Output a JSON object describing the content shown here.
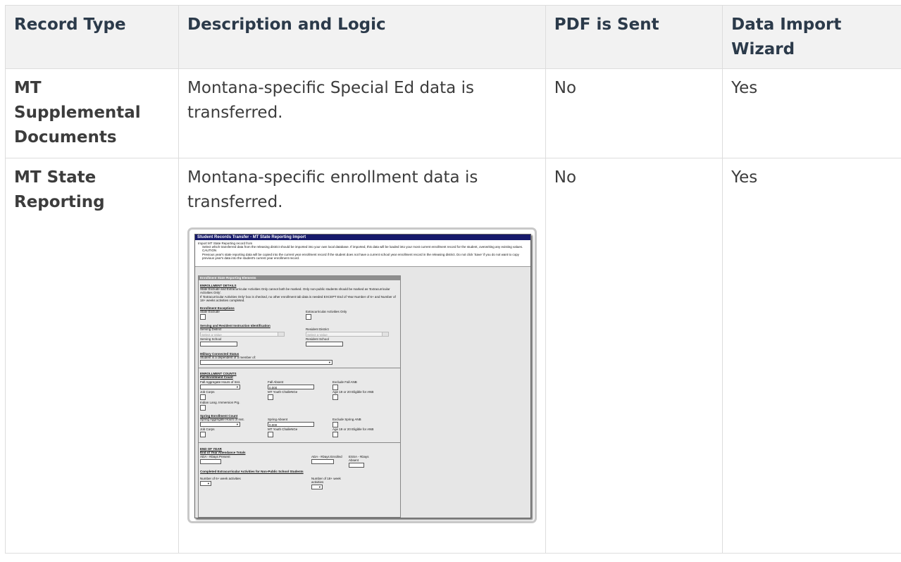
{
  "headers": [
    "Record Type",
    "Description and Logic",
    "PDF is Sent",
    "Data Import Wizard"
  ],
  "rows": [
    {
      "record_type": "MT Supplemental Documents",
      "description": "Montana-specific Special Ed data is transferred.",
      "pdf_sent": "No",
      "import_wizard": "Yes"
    },
    {
      "record_type": "MT State Reporting",
      "description": "Montana-specific enrollment data is transferred.",
      "pdf_sent": "No",
      "import_wizard": "Yes"
    }
  ],
  "shot": {
    "title": "Student Records Transfer - MT State Reporting Import",
    "import_line1": "Import MT State Reporting record from",
    "import_line2": "Select which transferred data from the releasing district should be imported into your own local database. If imported, this data will be loaded into your most current enrollment record for the student, overwriting any existing values.",
    "caution": "CAUTION",
    "caution_text": "Previous year's state reporting data will be copied into the current year enrollment record if the student does not have a current school year enrollment record in the releasing district. Do not click 'Save' if you do not want to copy previous year's data into the student's current year enrollment record.",
    "panel_title": "Enrollment State Reporting Elements",
    "enrollment_details": "ENROLLMENT DETAILS",
    "details_text1": "State Exclude and Extracurricular Activities Only cannot both be marked. Only non-public students should be marked as 'Extracurricular Activities Only'.",
    "details_text2": "If 'Extracurricular Activities Only' box is checked, no other enrollment tab data is needed EXCEPT End of Year Number of 6+ and Number of 18+ weeks activities completed.",
    "enrollment_exceptions": "Enrollment Exceptions",
    "state_exclude": "State Exclude",
    "extracurricular_only": "Extracurricular Activities Only",
    "serving_resident": "Serving and Resident Instruction Identification",
    "serving_district": "Serving District",
    "resident_district": "Resident District",
    "select_value": "Select a Value",
    "serving_school": "Serving School",
    "resident_school": "Resident School",
    "military": "Military Connected Status",
    "military_text": "Student is a dependent of a member of:",
    "enrollment_counts": "ENROLLMENT COUNTS",
    "fall_count": "Fall Enrollment Count",
    "fall_hours": "Fall Aggregate Hours of Inst.",
    "fall_absent": "Fall Absent",
    "fall_absent_value": "0.000",
    "exclude_fall": "Exclude Fall ANB",
    "job_corps": "Job Corps",
    "youth_challenge": "MT Youth ChalleNGe",
    "age_eligible": "Age 19 or 20 Eligible for ANB",
    "indian_lang": "Indian Lang. Immersion Prg.",
    "spring_count": "Spring Enrollment Count",
    "spring_hours": "Spring Aggregate Hours of Inst.",
    "spring_absent": "Spring Absent",
    "spring_absent_value": "0.000",
    "exclude_spring": "Exclude Spring ANB",
    "end_of_year": "END OF YEAR",
    "attendance_totals": "End of Year Attendance Totals",
    "ada_present": "ADA - #Days Present",
    "ada_enrolled": "ADA - #Days Enrolled",
    "essa_absent": "ESSA - #Days Absent",
    "completed_activities": "Completed Extracurricular Activities for Non-Public School Students",
    "num_6plus": "Number of 6+ week activities",
    "num_18plus": "Number of 18+ week activities"
  }
}
